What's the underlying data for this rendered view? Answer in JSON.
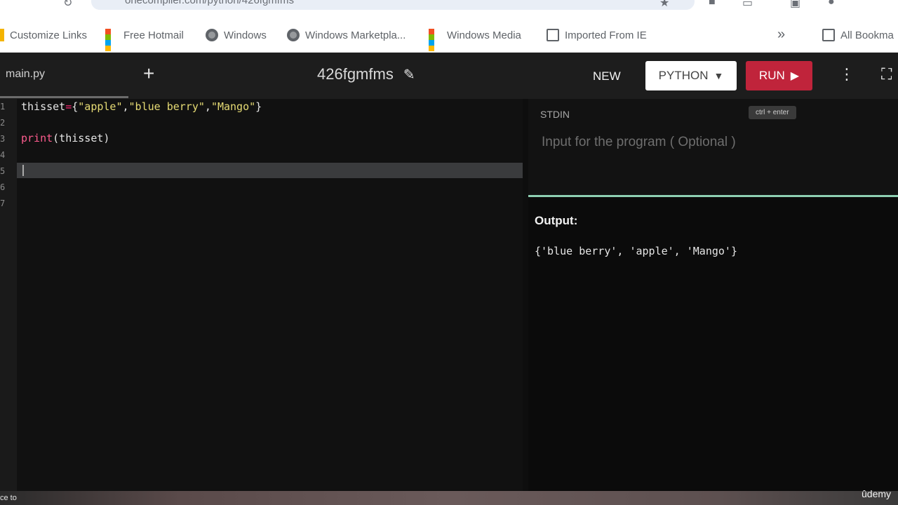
{
  "browser": {
    "address": "onecompiler.com/python/426fgmfms",
    "bookmarks": [
      {
        "label": "Customize Links",
        "icon": "bookmark-icon"
      },
      {
        "label": "Free Hotmail",
        "icon": "windows-logo-icon"
      },
      {
        "label": "Windows",
        "icon": "globe-icon"
      },
      {
        "label": "Windows Marketpla...",
        "icon": "globe-icon"
      },
      {
        "label": "Windows Media",
        "icon": "windows-logo-icon"
      },
      {
        "label": "Imported From IE",
        "icon": "folder-icon"
      },
      {
        "label": "All Bookma",
        "icon": "folder-icon"
      }
    ],
    "overflow_glyph": "»"
  },
  "header": {
    "file_tab": "main.py",
    "add_glyph": "+",
    "title": "426fgmfms",
    "new_label": "NEW",
    "language_label": "PYTHON",
    "run_label": "RUN"
  },
  "editor": {
    "line_numbers": [
      "1",
      "2",
      "3",
      "4",
      "5",
      "6",
      "7"
    ],
    "lines": {
      "l1": {
        "var": "thisset",
        "op": "=",
        "open": "{",
        "s1": "\"apple\"",
        "c1": ",",
        "s2": "\"blue berry\"",
        "c2": ",",
        "s3": "\"Mango\"",
        "close": "}"
      },
      "l3": {
        "fn": "print",
        "args": "(thisset)"
      }
    }
  },
  "stdin": {
    "label": "STDIN",
    "shortcut_hint": "ctrl + enter",
    "placeholder": "Input for the program ( Optional )",
    "value": ""
  },
  "output": {
    "label": "Output:",
    "text": "{'blue berry', 'apple', 'Mango'}"
  },
  "overlay": {
    "caption_left": "ce to",
    "watermark": "ûdemy"
  },
  "colors": {
    "run_button": "#c0243b",
    "accent_green": "#8ecfb2",
    "string_token": "#e6db74",
    "operator_token": "#f92672"
  }
}
